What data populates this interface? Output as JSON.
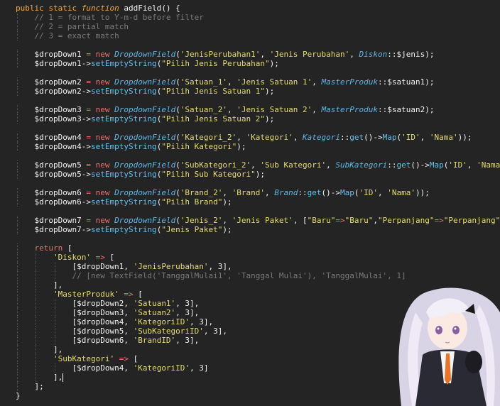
{
  "colors": {
    "background": "#242424",
    "keyword": "#f6a93b",
    "operator": "#ef6f6f",
    "class": "#60b6e8",
    "string": "#e6db74",
    "comment": "#7a7a7a",
    "default": "#f2f2f2"
  },
  "lines": [
    [
      {
        "t": "public static ",
        "c": "kw"
      },
      {
        "t": "function ",
        "c": "it"
      },
      {
        "t": "addField",
        "c": "fn"
      },
      {
        "t": "() {",
        "c": "pun"
      }
    ],
    [
      {
        "t": "    // 1 = format to Y-m-d before filter",
        "c": "com"
      }
    ],
    [
      {
        "t": "    // 2 = partial match",
        "c": "com"
      }
    ],
    [
      {
        "t": "    // 3 = exact match",
        "c": "com"
      }
    ],
    [],
    [
      {
        "t": "    $dropDown1 ",
        "c": "var"
      },
      {
        "t": "= ",
        "c": "op"
      },
      {
        "t": "new ",
        "c": "op"
      },
      {
        "t": "DropdownField",
        "c": "cls"
      },
      {
        "t": "(",
        "c": "pun"
      },
      {
        "t": "'JenisPerubahan1'",
        "c": "str"
      },
      {
        "t": ", ",
        "c": "pun"
      },
      {
        "t": "'Jenis Perubahan'",
        "c": "str"
      },
      {
        "t": ", ",
        "c": "pun"
      },
      {
        "t": "Diskon",
        "c": "cls"
      },
      {
        "t": "::$jenis);",
        "c": "pun"
      }
    ],
    [
      {
        "t": "    $dropDown1->",
        "c": "var"
      },
      {
        "t": "setEmptyString",
        "c": "meth"
      },
      {
        "t": "(",
        "c": "pun"
      },
      {
        "t": "\"Pilih Jenis Perubahan\"",
        "c": "str"
      },
      {
        "t": ");",
        "c": "pun"
      }
    ],
    [],
    [
      {
        "t": "    $dropDown2 ",
        "c": "var"
      },
      {
        "t": "= ",
        "c": "op"
      },
      {
        "t": "new ",
        "c": "op"
      },
      {
        "t": "DropdownField",
        "c": "cls"
      },
      {
        "t": "(",
        "c": "pun"
      },
      {
        "t": "'Satuan_1'",
        "c": "str"
      },
      {
        "t": ", ",
        "c": "pun"
      },
      {
        "t": "'Jenis Satuan 1'",
        "c": "str"
      },
      {
        "t": ", ",
        "c": "pun"
      },
      {
        "t": "MasterProduk",
        "c": "cls"
      },
      {
        "t": "::$satuan1);",
        "c": "pun"
      }
    ],
    [
      {
        "t": "    $dropDown2->",
        "c": "var"
      },
      {
        "t": "setEmptyString",
        "c": "meth"
      },
      {
        "t": "(",
        "c": "pun"
      },
      {
        "t": "\"Pilih Jenis Satuan 1\"",
        "c": "str"
      },
      {
        "t": ");",
        "c": "pun"
      }
    ],
    [],
    [
      {
        "t": "    $dropDown3 ",
        "c": "var"
      },
      {
        "t": "= ",
        "c": "op"
      },
      {
        "t": "new ",
        "c": "op"
      },
      {
        "t": "DropdownField",
        "c": "cls"
      },
      {
        "t": "(",
        "c": "pun"
      },
      {
        "t": "'Satuan_2'",
        "c": "str"
      },
      {
        "t": ", ",
        "c": "pun"
      },
      {
        "t": "'Jenis Satuan 2'",
        "c": "str"
      },
      {
        "t": ", ",
        "c": "pun"
      },
      {
        "t": "MasterProduk",
        "c": "cls"
      },
      {
        "t": "::$satuan2);",
        "c": "pun"
      }
    ],
    [
      {
        "t": "    $dropDown3->",
        "c": "var"
      },
      {
        "t": "setEmptyString",
        "c": "meth"
      },
      {
        "t": "(",
        "c": "pun"
      },
      {
        "t": "\"Pilih Jenis Satuan 2\"",
        "c": "str"
      },
      {
        "t": ");",
        "c": "pun"
      }
    ],
    [],
    [
      {
        "t": "    $dropDown4 ",
        "c": "var"
      },
      {
        "t": "= ",
        "c": "op"
      },
      {
        "t": "new ",
        "c": "op"
      },
      {
        "t": "DropdownField",
        "c": "cls"
      },
      {
        "t": "(",
        "c": "pun"
      },
      {
        "t": "'Kategori_2'",
        "c": "str"
      },
      {
        "t": ", ",
        "c": "pun"
      },
      {
        "t": "'Kategori'",
        "c": "str"
      },
      {
        "t": ", ",
        "c": "pun"
      },
      {
        "t": "Kategori",
        "c": "cls"
      },
      {
        "t": "::",
        "c": "pun"
      },
      {
        "t": "get",
        "c": "meth"
      },
      {
        "t": "()->",
        "c": "pun"
      },
      {
        "t": "Map",
        "c": "meth"
      },
      {
        "t": "(",
        "c": "pun"
      },
      {
        "t": "'ID'",
        "c": "str"
      },
      {
        "t": ", ",
        "c": "pun"
      },
      {
        "t": "'Nama'",
        "c": "str"
      },
      {
        "t": "));",
        "c": "pun"
      }
    ],
    [
      {
        "t": "    $dropDown4->",
        "c": "var"
      },
      {
        "t": "setEmptyString",
        "c": "meth"
      },
      {
        "t": "(",
        "c": "pun"
      },
      {
        "t": "\"Pilih Kategori\"",
        "c": "str"
      },
      {
        "t": ");",
        "c": "pun"
      }
    ],
    [],
    [
      {
        "t": "    $dropDown5 ",
        "c": "var"
      },
      {
        "t": "= ",
        "c": "op"
      },
      {
        "t": "new ",
        "c": "op"
      },
      {
        "t": "DropdownField",
        "c": "cls"
      },
      {
        "t": "(",
        "c": "pun"
      },
      {
        "t": "'SubKategori_2'",
        "c": "str"
      },
      {
        "t": ", ",
        "c": "pun"
      },
      {
        "t": "'Sub Kategori'",
        "c": "str"
      },
      {
        "t": ", ",
        "c": "pun"
      },
      {
        "t": "SubKategori",
        "c": "cls"
      },
      {
        "t": "::",
        "c": "pun"
      },
      {
        "t": "get",
        "c": "meth"
      },
      {
        "t": "()->",
        "c": "pun"
      },
      {
        "t": "Map",
        "c": "meth"
      },
      {
        "t": "(",
        "c": "pun"
      },
      {
        "t": "'ID'",
        "c": "str"
      },
      {
        "t": ", ",
        "c": "pun"
      },
      {
        "t": "'Nama'",
        "c": "str"
      },
      {
        "t": "));",
        "c": "pun"
      }
    ],
    [
      {
        "t": "    $dropDown5->",
        "c": "var"
      },
      {
        "t": "setEmptyString",
        "c": "meth"
      },
      {
        "t": "(",
        "c": "pun"
      },
      {
        "t": "\"Pilih Sub Kategori\"",
        "c": "str"
      },
      {
        "t": ");",
        "c": "pun"
      }
    ],
    [],
    [
      {
        "t": "    $dropDown6 ",
        "c": "var"
      },
      {
        "t": "= ",
        "c": "op"
      },
      {
        "t": "new ",
        "c": "op"
      },
      {
        "t": "DropdownField",
        "c": "cls"
      },
      {
        "t": "(",
        "c": "pun"
      },
      {
        "t": "'Brand_2'",
        "c": "str"
      },
      {
        "t": ", ",
        "c": "pun"
      },
      {
        "t": "'Brand'",
        "c": "str"
      },
      {
        "t": ", ",
        "c": "pun"
      },
      {
        "t": "Brand",
        "c": "cls"
      },
      {
        "t": "::",
        "c": "pun"
      },
      {
        "t": "get",
        "c": "meth"
      },
      {
        "t": "()->",
        "c": "pun"
      },
      {
        "t": "Map",
        "c": "meth"
      },
      {
        "t": "(",
        "c": "pun"
      },
      {
        "t": "'ID'",
        "c": "str"
      },
      {
        "t": ", ",
        "c": "pun"
      },
      {
        "t": "'Nama'",
        "c": "str"
      },
      {
        "t": "));",
        "c": "pun"
      }
    ],
    [
      {
        "t": "    $dropDown6->",
        "c": "var"
      },
      {
        "t": "setEmptyString",
        "c": "meth"
      },
      {
        "t": "(",
        "c": "pun"
      },
      {
        "t": "\"Pilih Brand\"",
        "c": "str"
      },
      {
        "t": ");",
        "c": "pun"
      }
    ],
    [],
    [
      {
        "t": "    $dropDown7 ",
        "c": "var"
      },
      {
        "t": "= ",
        "c": "op"
      },
      {
        "t": "new ",
        "c": "op"
      },
      {
        "t": "DropdownField",
        "c": "cls"
      },
      {
        "t": "(",
        "c": "pun"
      },
      {
        "t": "'Jenis_2'",
        "c": "str"
      },
      {
        "t": ", ",
        "c": "pun"
      },
      {
        "t": "'Jenis Paket'",
        "c": "str"
      },
      {
        "t": ", [",
        "c": "pun"
      },
      {
        "t": "\"Baru\"",
        "c": "str"
      },
      {
        "t": "=>",
        "c": "op"
      },
      {
        "t": "\"Baru\"",
        "c": "str"
      },
      {
        "t": ",",
        "c": "pun"
      },
      {
        "t": "\"Perpanjang\"",
        "c": "str"
      },
      {
        "t": "=>",
        "c": "op"
      },
      {
        "t": "\"Perpanjang\"",
        "c": "str"
      },
      {
        "t": "]);",
        "c": "pun"
      }
    ],
    [
      {
        "t": "    $dropDown7->",
        "c": "var"
      },
      {
        "t": "setEmptyString",
        "c": "meth"
      },
      {
        "t": "(",
        "c": "pun"
      },
      {
        "t": "\"Jenis Paket\"",
        "c": "str"
      },
      {
        "t": ");",
        "c": "pun"
      }
    ],
    [],
    [
      {
        "t": "    ",
        "c": "pun"
      },
      {
        "t": "return ",
        "c": "op"
      },
      {
        "t": "[",
        "c": "pun"
      }
    ],
    [
      {
        "t": "        ",
        "c": "pun"
      },
      {
        "t": "'Diskon'",
        "c": "str"
      },
      {
        "t": " ",
        "c": "pun"
      },
      {
        "t": "=> ",
        "c": "op"
      },
      {
        "t": "[",
        "c": "pun"
      }
    ],
    [
      {
        "t": "            [$dropDown1, ",
        "c": "pun"
      },
      {
        "t": "'JenisPerubahan'",
        "c": "str"
      },
      {
        "t": ", 3],",
        "c": "pun"
      }
    ],
    [
      {
        "t": "            // [new TextField('TanggalMulai1', 'Tanggal Mulai'), 'TanggalMulai', 1]",
        "c": "com"
      }
    ],
    [
      {
        "t": "        ],",
        "c": "pun"
      }
    ],
    [
      {
        "t": "        ",
        "c": "pun"
      },
      {
        "t": "'MasterProduk'",
        "c": "str"
      },
      {
        "t": " ",
        "c": "pun"
      },
      {
        "t": "=> ",
        "c": "op"
      },
      {
        "t": "[",
        "c": "pun"
      }
    ],
    [
      {
        "t": "            [$dropDown2, ",
        "c": "pun"
      },
      {
        "t": "'Satuan1'",
        "c": "str"
      },
      {
        "t": ", 3],",
        "c": "pun"
      }
    ],
    [
      {
        "t": "            [$dropDown3, ",
        "c": "pun"
      },
      {
        "t": "'Satuan2'",
        "c": "str"
      },
      {
        "t": ", 3],",
        "c": "pun"
      }
    ],
    [
      {
        "t": "            [$dropDown4, ",
        "c": "pun"
      },
      {
        "t": "'KategoriID'",
        "c": "str"
      },
      {
        "t": ", 3],",
        "c": "pun"
      }
    ],
    [
      {
        "t": "            [$dropDown5, ",
        "c": "pun"
      },
      {
        "t": "'SubKategoriID'",
        "c": "str"
      },
      {
        "t": ", 3],",
        "c": "pun"
      }
    ],
    [
      {
        "t": "            [$dropDown6, ",
        "c": "pun"
      },
      {
        "t": "'BrandID'",
        "c": "str"
      },
      {
        "t": ", 3],",
        "c": "pun"
      }
    ],
    [
      {
        "t": "        ],",
        "c": "pun"
      }
    ],
    [
      {
        "t": "        ",
        "c": "pun"
      },
      {
        "t": "'SubKategori'",
        "c": "str"
      },
      {
        "t": " ",
        "c": "pun"
      },
      {
        "t": "=> ",
        "c": "op"
      },
      {
        "t": "[",
        "c": "pun"
      }
    ],
    [
      {
        "t": "            [$dropDown4, ",
        "c": "pun"
      },
      {
        "t": "'KategoriID'",
        "c": "str"
      },
      {
        "t": ", 3]",
        "c": "pun"
      }
    ],
    [
      {
        "t": "        ],",
        "c": "pun"
      }
    ],
    [
      {
        "t": "    ];",
        "c": "pun"
      }
    ],
    [
      {
        "t": "}",
        "c": "pun"
      }
    ]
  ]
}
